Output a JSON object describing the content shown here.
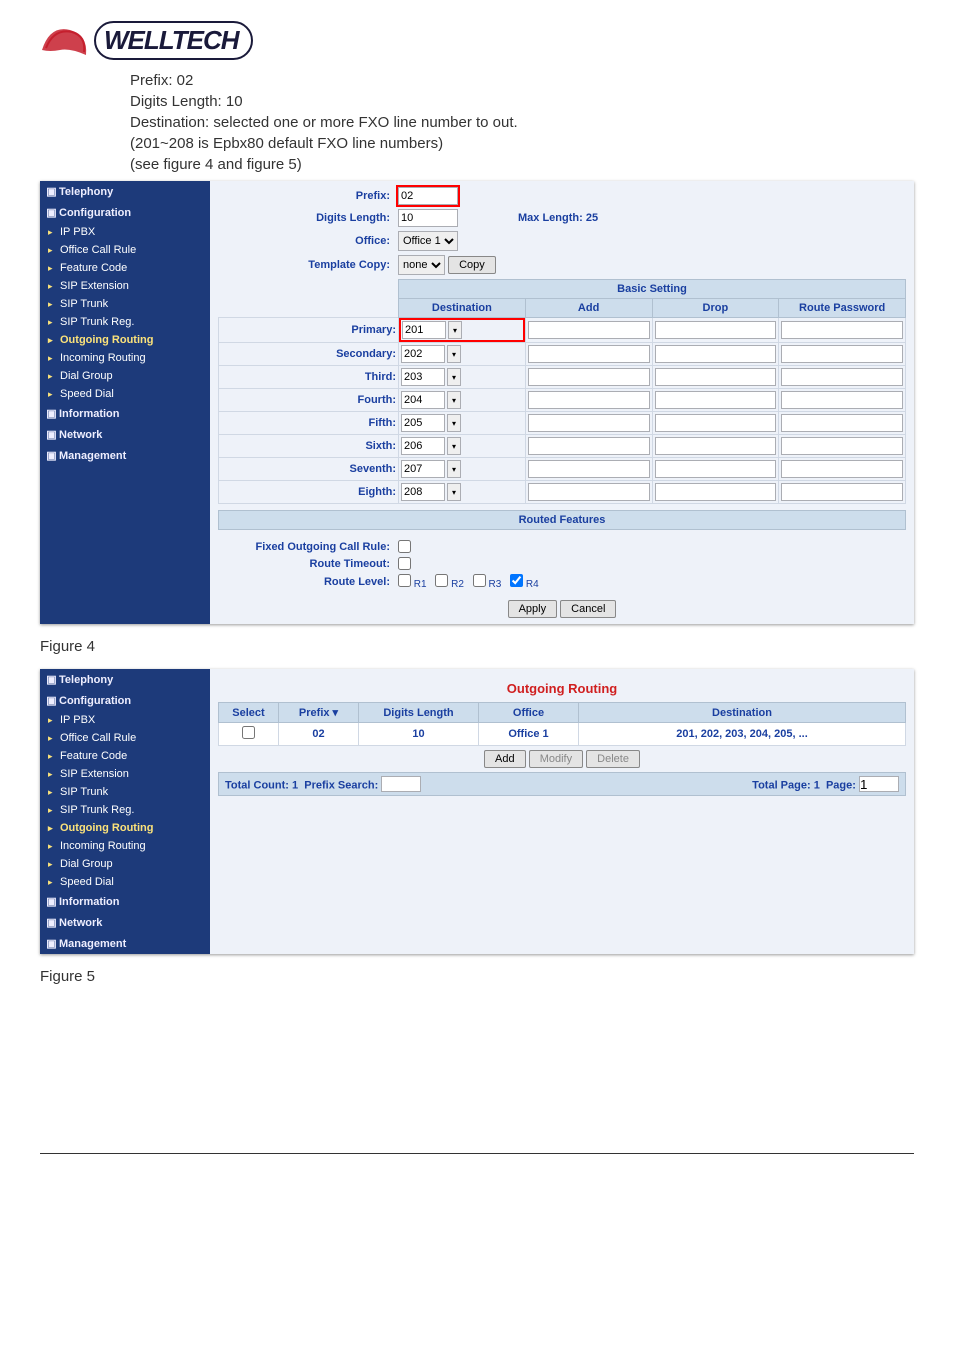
{
  "logo_text": "WELLTECH",
  "doc_lines": [
    "Prefix: 02",
    "Digits Length: 10",
    "Destination: selected one or more FXO line number to out.",
    "(201~208 is Epbx80 default FXO line numbers)",
    "(see figure 4 and figure 5)"
  ],
  "figure4_caption": "Figure 4",
  "figure5_caption": "Figure 5",
  "sidebar": {
    "telephony": "Telephony",
    "configuration": "Configuration",
    "items": [
      {
        "label": "IP PBX"
      },
      {
        "label": "Office Call Rule"
      },
      {
        "label": "Feature Code"
      },
      {
        "label": "SIP Extension"
      },
      {
        "label": "SIP Trunk"
      },
      {
        "label": "SIP Trunk Reg."
      },
      {
        "label": "Outgoing Routing"
      },
      {
        "label": "Incoming Routing"
      },
      {
        "label": "Dial Group"
      },
      {
        "label": "Speed Dial"
      }
    ],
    "information": "Information",
    "network": "Network",
    "management": "Management"
  },
  "form": {
    "prefix_label": "Prefix:",
    "prefix_value": "02",
    "digits_length_label": "Digits Length:",
    "digits_length_value": "10",
    "max_length_label": "Max Length: 25",
    "office_label": "Office:",
    "office_value": "Office 1",
    "template_copy_label": "Template Copy:",
    "template_copy_value": "none",
    "copy_btn": "Copy"
  },
  "basic_setting": {
    "title": "Basic Setting",
    "cols": {
      "dest": "Destination",
      "add": "Add",
      "drop": "Drop",
      "rpw": "Route Password"
    },
    "rows": [
      {
        "label": "Primary:",
        "dest": "201"
      },
      {
        "label": "Secondary:",
        "dest": "202"
      },
      {
        "label": "Third:",
        "dest": "203"
      },
      {
        "label": "Fourth:",
        "dest": "204"
      },
      {
        "label": "Fifth:",
        "dest": "205"
      },
      {
        "label": "Sixth:",
        "dest": "206"
      },
      {
        "label": "Seventh:",
        "dest": "207"
      },
      {
        "label": "Eighth:",
        "dest": "208"
      }
    ]
  },
  "routed_features": {
    "title": "Routed Features",
    "fixed_label": "Fixed Outgoing Call Rule:",
    "timeout_label": "Route Timeout:",
    "level_label": "Route Level:",
    "levels": [
      "R1",
      "R2",
      "R3",
      "R4"
    ],
    "apply": "Apply",
    "cancel": "Cancel"
  },
  "list": {
    "title": "Outgoing Routing",
    "cols": {
      "select": "Select",
      "prefix": "Prefix",
      "dl": "Digits Length",
      "office": "Office",
      "dest": "Destination"
    },
    "row": {
      "prefix": "02",
      "dl": "10",
      "office": "Office 1",
      "dest": "201, 202, 203, 204, 205, ..."
    },
    "add": "Add",
    "modify": "Modify",
    "delete": "Delete",
    "total_count_label": "Total Count:",
    "total_count": "1",
    "prefix_search_label": "Prefix Search:",
    "total_page_label": "Total Page:",
    "total_page": "1",
    "page_label": "Page:",
    "page_value": "1"
  }
}
